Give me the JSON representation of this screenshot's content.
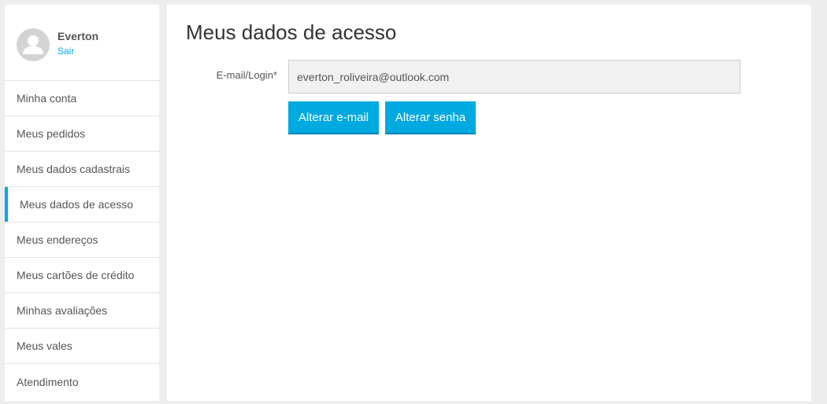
{
  "user": {
    "name": "Everton",
    "logout_label": "Sair"
  },
  "sidebar": {
    "items": [
      {
        "label": "Minha conta"
      },
      {
        "label": "Meus pedidos"
      },
      {
        "label": "Meus dados cadastrais"
      },
      {
        "label": "Meus dados de acesso",
        "active": true
      },
      {
        "label": "Meus endereços"
      },
      {
        "label": "Meus cartões de crédito"
      },
      {
        "label": "Minhas avaliações"
      },
      {
        "label": "Meus vales"
      },
      {
        "label": "Atendimento"
      }
    ]
  },
  "main": {
    "title": "Meus dados de acesso",
    "email_label": "E-mail/Login*",
    "email_value": "everton_roliveira@outlook.com",
    "change_email_label": "Alterar e-mail",
    "change_password_label": "Alterar senha"
  },
  "colors": {
    "accent": "#00a9e0",
    "background": "#ededed"
  },
  "icons": {
    "avatar": "user-silhouette-icon"
  }
}
